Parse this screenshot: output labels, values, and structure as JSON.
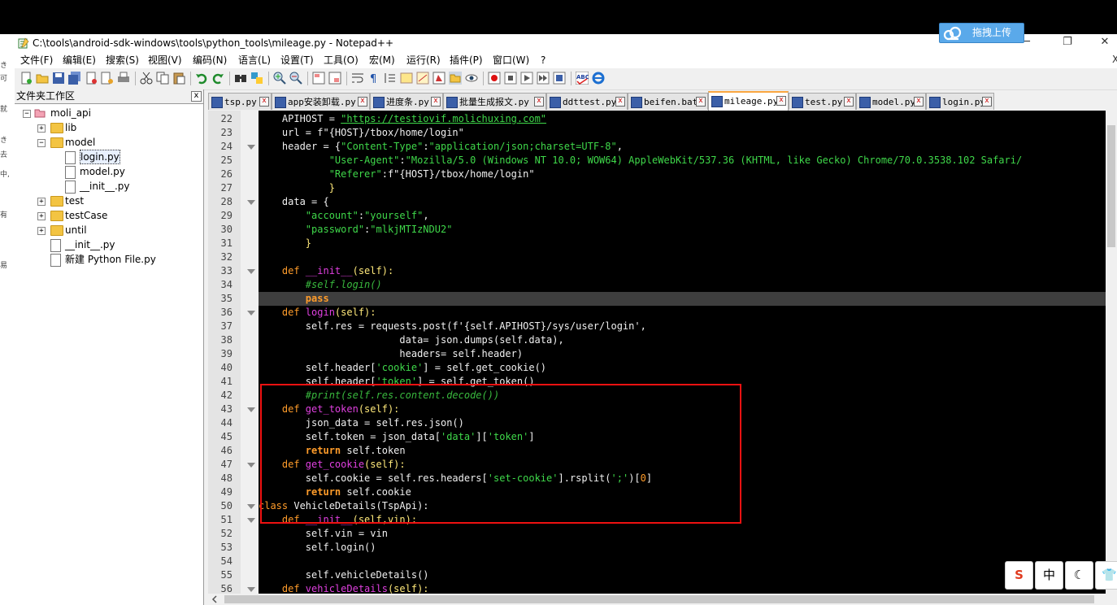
{
  "window": {
    "title": "C:\\tools\\android-sdk-windows\\tools\\python_tools\\mileage.py - Notepad++",
    "minimize": "─",
    "restore": "❐",
    "close": "✕"
  },
  "left_strip": [
    "き",
    "可",
    "就",
    "き",
    "去",
    "中,",
    "有",
    "易"
  ],
  "menu": [
    "文件(F)",
    "编辑(E)",
    "搜索(S)",
    "视图(V)",
    "编码(N)",
    "语言(L)",
    "设置(T)",
    "工具(O)",
    "宏(M)",
    "运行(R)",
    "插件(P)",
    "窗口(W)",
    "?"
  ],
  "menu_close": "X",
  "upload": {
    "label": "拖拽上传",
    "icon": "cloud-icon"
  },
  "panel": {
    "title": "文件夹工作区",
    "close": "x",
    "tree": [
      {
        "label": "moli_api",
        "kind": "project",
        "expander": "−",
        "level": 0
      },
      {
        "label": "lib",
        "kind": "folder",
        "expander": "+",
        "level": 1
      },
      {
        "label": "model",
        "kind": "folder",
        "expander": "−",
        "level": 1
      },
      {
        "label": "login.py",
        "kind": "file",
        "expander": "",
        "level": 2,
        "selected": true
      },
      {
        "label": "model.py",
        "kind": "file",
        "expander": "",
        "level": 2
      },
      {
        "label": "__init__.py",
        "kind": "file",
        "expander": "",
        "level": 2
      },
      {
        "label": "test",
        "kind": "folder",
        "expander": "+",
        "level": 1
      },
      {
        "label": "testCase",
        "kind": "folder",
        "expander": "+",
        "level": 1
      },
      {
        "label": "until",
        "kind": "folder",
        "expander": "+",
        "level": 1
      },
      {
        "label": "__init__.py",
        "kind": "file",
        "expander": "",
        "level": 1
      },
      {
        "label": "新建 Python File.py",
        "kind": "file",
        "expander": "",
        "level": 1
      }
    ]
  },
  "tabs": [
    {
      "label": "tsp.py",
      "active": false
    },
    {
      "label": "app安装卸载.py",
      "active": false
    },
    {
      "label": "进度条.py",
      "active": false
    },
    {
      "label": "批量生成报文.py",
      "active": false
    },
    {
      "label": "ddttest.py",
      "active": false
    },
    {
      "label": "beifen.bat",
      "active": false
    },
    {
      "label": "mileage.py",
      "active": true
    },
    {
      "label": "test.py",
      "active": false
    },
    {
      "label": "model.py",
      "active": false
    },
    {
      "label": "login.py",
      "active": false
    }
  ],
  "tab_close": "x",
  "editor": {
    "current_line": 35,
    "lines": [
      {
        "n": "22",
        "fold": false,
        "segs": [
          [
            "v",
            "    APIHOST = "
          ],
          [
            "u",
            "\"https://testiovif.molichuxing.com\""
          ]
        ]
      },
      {
        "n": "23",
        "fold": false,
        "segs": [
          [
            "v",
            "    url = f\"{HOST}/tbox/home/login\""
          ]
        ]
      },
      {
        "n": "24",
        "fold": true,
        "segs": [
          [
            "v",
            "    header = {"
          ],
          [
            "s",
            "\"Content-Type\""
          ],
          [
            "v",
            ":"
          ],
          [
            "s",
            "\"application/json;charset=UTF-8\""
          ],
          [
            "v",
            ","
          ]
        ]
      },
      {
        "n": "25",
        "fold": false,
        "segs": [
          [
            "s",
            "            \"User-Agent\""
          ],
          [
            "v",
            ":"
          ],
          [
            "s",
            "\"Mozilla/5.0 (Windows NT 10.0; WOW64) AppleWebKit/537.36 (KHTML, like Gecko) Chrome/70.0.3538.102 Safari/"
          ]
        ]
      },
      {
        "n": "26",
        "fold": false,
        "segs": [
          [
            "s",
            "            \"Referer\""
          ],
          [
            "v",
            ":f\"{HOST}/tbox/home/login\""
          ]
        ]
      },
      {
        "n": "27",
        "fold": false,
        "segs": [
          [
            "y",
            "            }"
          ]
        ]
      },
      {
        "n": "28",
        "fold": true,
        "segs": [
          [
            "v",
            "    data = {"
          ]
        ]
      },
      {
        "n": "29",
        "fold": false,
        "segs": [
          [
            "s",
            "        \"account\""
          ],
          [
            "v",
            ":"
          ],
          [
            "s",
            "\"yourself\""
          ],
          [
            "v",
            ","
          ]
        ]
      },
      {
        "n": "30",
        "fold": false,
        "segs": [
          [
            "s",
            "        \"password\""
          ],
          [
            "v",
            ":"
          ],
          [
            "s",
            "\"mlkjMTIzNDU2\""
          ]
        ]
      },
      {
        "n": "31",
        "fold": false,
        "segs": [
          [
            "y",
            "        }"
          ]
        ]
      },
      {
        "n": "32",
        "fold": false,
        "segs": [
          [
            "v",
            ""
          ]
        ]
      },
      {
        "n": "33",
        "fold": true,
        "segs": [
          [
            "k",
            "    def "
          ],
          [
            "f",
            "__init__"
          ],
          [
            "y",
            "(self):"
          ]
        ]
      },
      {
        "n": "34",
        "fold": false,
        "segs": [
          [
            "c",
            "        #self.login()"
          ]
        ]
      },
      {
        "n": "35",
        "fold": false,
        "segs": [
          [
            "b",
            "        pass"
          ]
        ]
      },
      {
        "n": "36",
        "fold": true,
        "segs": [
          [
            "k",
            "    def "
          ],
          [
            "f",
            "login"
          ],
          [
            "y",
            "(self):"
          ]
        ]
      },
      {
        "n": "37",
        "fold": false,
        "segs": [
          [
            "v",
            "        self.res = requests.post(f'{self.APIHOST}/sys/user/login',"
          ]
        ]
      },
      {
        "n": "38",
        "fold": false,
        "segs": [
          [
            "v",
            "                        data= json.dumps(self.data),"
          ]
        ]
      },
      {
        "n": "39",
        "fold": false,
        "segs": [
          [
            "v",
            "                        headers= self.header)"
          ]
        ]
      },
      {
        "n": "40",
        "fold": false,
        "segs": [
          [
            "v",
            "        self.header["
          ],
          [
            "s",
            "'cookie'"
          ],
          [
            "v",
            "] = self.get_cookie()"
          ]
        ]
      },
      {
        "n": "41",
        "fold": false,
        "segs": [
          [
            "v",
            "        self.header["
          ],
          [
            "s",
            "'token'"
          ],
          [
            "v",
            "] = self.get_token()"
          ]
        ]
      },
      {
        "n": "42",
        "fold": false,
        "segs": [
          [
            "c",
            "        #print(self.res.content.decode())"
          ]
        ]
      },
      {
        "n": "43",
        "fold": true,
        "segs": [
          [
            "k",
            "    def "
          ],
          [
            "f",
            "get_token"
          ],
          [
            "y",
            "(self):"
          ]
        ]
      },
      {
        "n": "44",
        "fold": false,
        "segs": [
          [
            "v",
            "        json_data = self.res.json()"
          ]
        ]
      },
      {
        "n": "45",
        "fold": false,
        "segs": [
          [
            "v",
            "        self.token = json_data["
          ],
          [
            "s",
            "'data'"
          ],
          [
            "v",
            "]["
          ],
          [
            "s",
            "'token'"
          ],
          [
            "v",
            "]"
          ]
        ]
      },
      {
        "n": "46",
        "fold": false,
        "segs": [
          [
            "b",
            "        return"
          ],
          [
            "v",
            " self.token"
          ]
        ]
      },
      {
        "n": "47",
        "fold": true,
        "segs": [
          [
            "k",
            "    def "
          ],
          [
            "f",
            "get_cookie"
          ],
          [
            "y",
            "(self):"
          ]
        ]
      },
      {
        "n": "48",
        "fold": false,
        "segs": [
          [
            "v",
            "        self.cookie = self.res.headers["
          ],
          [
            "s",
            "'set-cookie'"
          ],
          [
            "v",
            "].rsplit("
          ],
          [
            "s",
            "';'"
          ],
          [
            "v",
            ")["
          ],
          [
            "n",
            "0"
          ],
          [
            "v",
            "]"
          ]
        ]
      },
      {
        "n": "49",
        "fold": false,
        "segs": [
          [
            "b",
            "        return"
          ],
          [
            "v",
            " self.cookie"
          ]
        ]
      },
      {
        "n": "50",
        "fold": true,
        "segs": [
          [
            "k",
            "class "
          ],
          [
            "v",
            "VehicleDetails(TspApi):"
          ]
        ]
      },
      {
        "n": "51",
        "fold": true,
        "segs": [
          [
            "k",
            "    def "
          ],
          [
            "f",
            "__init__"
          ],
          [
            "y",
            "(self,vin):"
          ]
        ]
      },
      {
        "n": "52",
        "fold": false,
        "segs": [
          [
            "v",
            "        self.vin = vin"
          ]
        ]
      },
      {
        "n": "53",
        "fold": false,
        "segs": [
          [
            "v",
            "        self.login()"
          ]
        ]
      },
      {
        "n": "54",
        "fold": false,
        "segs": [
          [
            "v",
            ""
          ]
        ]
      },
      {
        "n": "55",
        "fold": false,
        "segs": [
          [
            "v",
            "        self.vehicleDetails()"
          ]
        ]
      },
      {
        "n": "56",
        "fold": true,
        "segs": [
          [
            "k",
            "    def "
          ],
          [
            "f",
            "vehicleDetails"
          ],
          [
            "y",
            "(self):"
          ]
        ]
      }
    ]
  },
  "ime_toolbar": [
    "S",
    "中",
    "☾",
    "👕"
  ]
}
